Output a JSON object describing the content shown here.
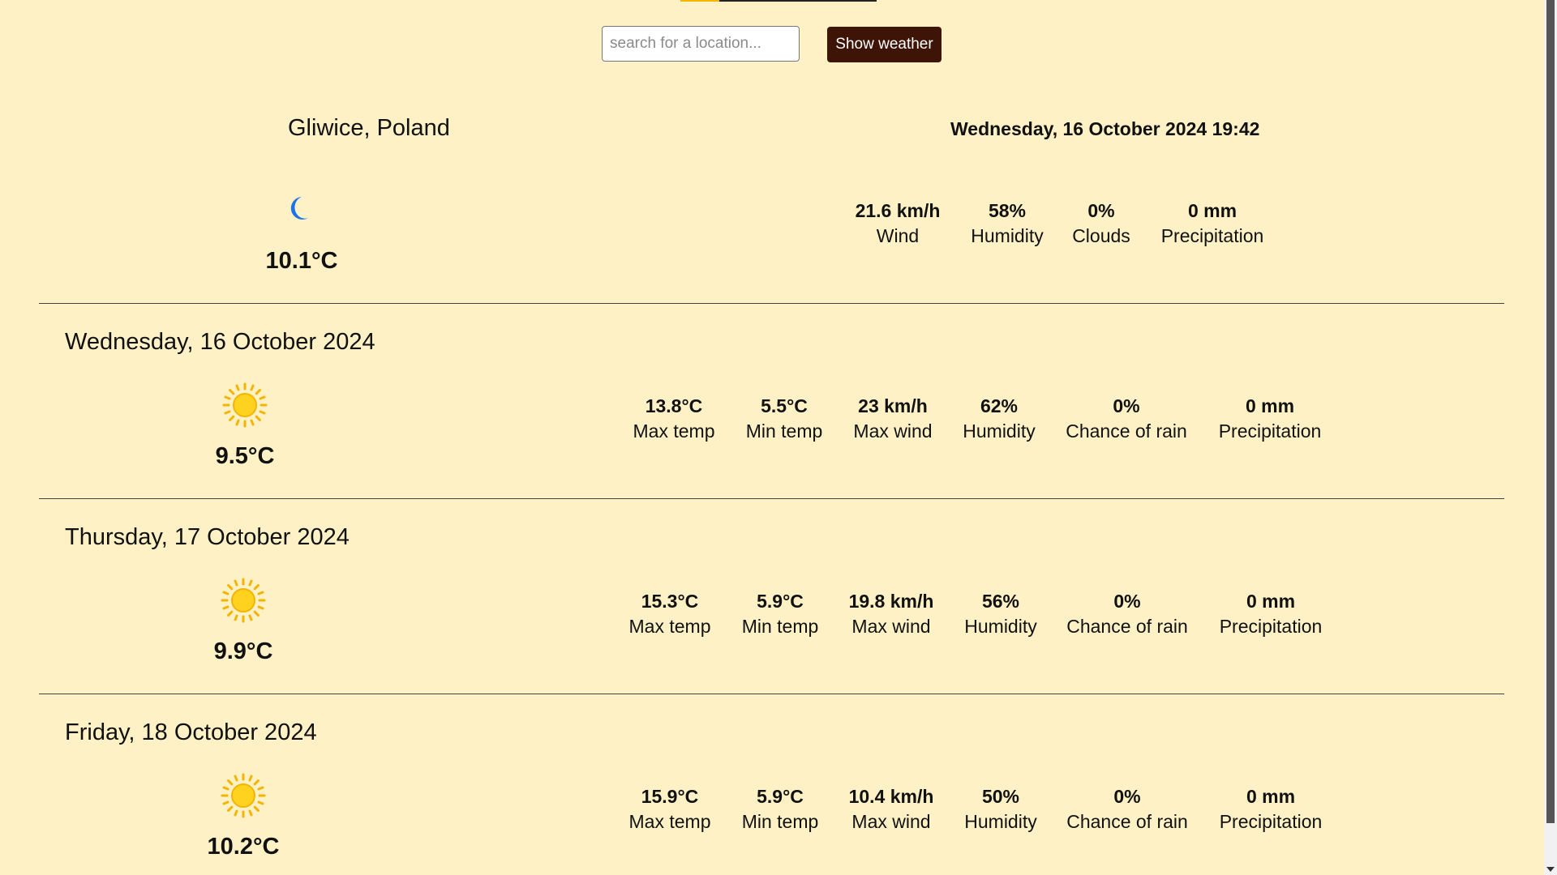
{
  "search": {
    "placeholder": "search for a location...",
    "button_label": "Show weather"
  },
  "current": {
    "location": "Gliwice, Poland",
    "datetime": "Wednesday, 16 October 2024 19:42",
    "icon": "moon-icon",
    "temperature": "10.1°C",
    "stats": [
      {
        "value": "21.6 km/h",
        "label": "Wind"
      },
      {
        "value": "58%",
        "label": "Humidity"
      },
      {
        "value": "0%",
        "label": "Clouds"
      },
      {
        "value": "0 mm",
        "label": "Precipitation"
      }
    ]
  },
  "forecast": [
    {
      "date": "Wednesday, 16 October 2024",
      "icon": "sun-icon",
      "temperature": "9.5°C",
      "stats": [
        {
          "value": "13.8°C",
          "label": "Max temp"
        },
        {
          "value": "5.5°C",
          "label": "Min temp"
        },
        {
          "value": "23 km/h",
          "label": "Max wind"
        },
        {
          "value": "62%",
          "label": "Humidity"
        },
        {
          "value": "0%",
          "label": "Chance of rain"
        },
        {
          "value": "0 mm",
          "label": "Precipitation"
        }
      ]
    },
    {
      "date": "Thursday, 17 October 2024",
      "icon": "sun-icon",
      "temperature": "9.9°C",
      "stats": [
        {
          "value": "15.3°C",
          "label": "Max temp"
        },
        {
          "value": "5.9°C",
          "label": "Min temp"
        },
        {
          "value": "19.8 km/h",
          "label": "Max wind"
        },
        {
          "value": "56%",
          "label": "Humidity"
        },
        {
          "value": "0%",
          "label": "Chance of rain"
        },
        {
          "value": "0 mm",
          "label": "Precipitation"
        }
      ]
    },
    {
      "date": "Friday, 18 October 2024",
      "icon": "sun-icon",
      "temperature": "10.2°C",
      "stats": [
        {
          "value": "15.9°C",
          "label": "Max temp"
        },
        {
          "value": "5.9°C",
          "label": "Min temp"
        },
        {
          "value": "10.4 km/h",
          "label": "Max wind"
        },
        {
          "value": "50%",
          "label": "Humidity"
        },
        {
          "value": "0%",
          "label": "Chance of rain"
        },
        {
          "value": "0 mm",
          "label": "Precipitation"
        }
      ]
    }
  ],
  "colors": {
    "background": "#fdf1c5",
    "button": "#3d1405",
    "sun": "#f4b400",
    "moon": "#1a73e8"
  }
}
